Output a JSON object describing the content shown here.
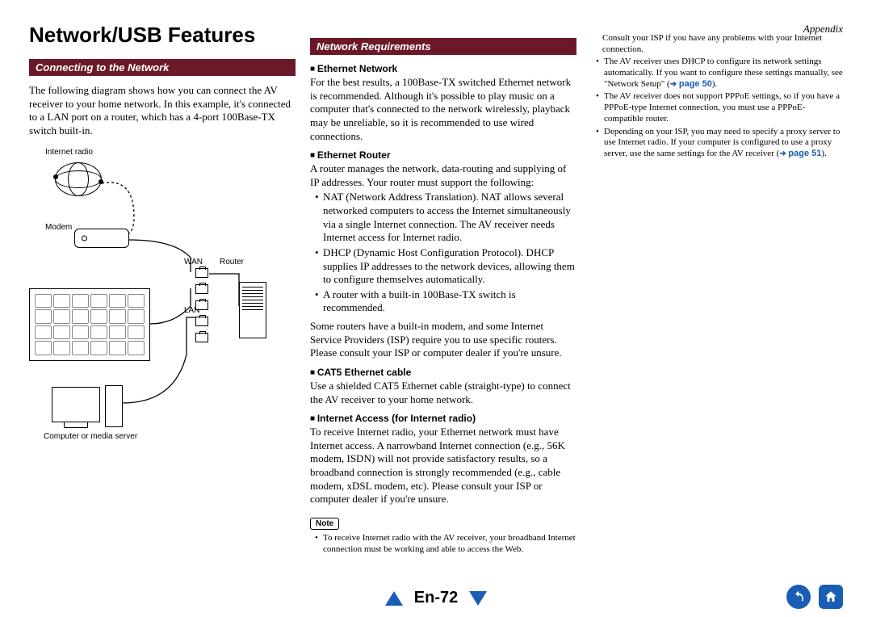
{
  "appendix": "Appendix",
  "heading": "Network/USB Features",
  "section1": {
    "title": "Connecting to the Network",
    "intro": "The following diagram shows how you can connect the AV receiver to your home network. In this example, it's connected to a LAN port on a router, which has a 4-port 100Base-TX switch built-in.",
    "labels": {
      "internet_radio": "Internet radio",
      "modem": "Modem",
      "wan": "WAN",
      "lan": "LAN",
      "router": "Router",
      "computer": "Computer or media server"
    }
  },
  "section2": {
    "title": "Network Requirements",
    "eth_net_h": "Ethernet Network",
    "eth_net_p": "For the best results, a 100Base-TX switched Ethernet network is recommended. Although it's possible to play music on a computer that's connected to the network wirelessly, playback may be unreliable, so it is recommended to use wired connections.",
    "eth_router_h": "Ethernet Router",
    "eth_router_p": "A router manages the network, data-routing and supplying of IP addresses. Your router must support the following:",
    "router_bullets": [
      "NAT (Network Address Translation). NAT allows several networked computers to access the Internet simultaneously via a single Internet connection. The AV receiver needs Internet access for Internet radio.",
      "DHCP (Dynamic Host Configuration Protocol). DHCP supplies IP addresses to the network devices, allowing them to configure themselves automatically.",
      "A router with a built-in 100Base-TX switch is recommended."
    ],
    "router_tail": "Some routers have a built-in modem, and some Internet Service Providers (ISP) require you to use specific routers. Please consult your ISP or computer dealer if you're unsure.",
    "cat5_h": "CAT5 Ethernet cable",
    "cat5_p": "Use a shielded CAT5 Ethernet cable (straight-type) to connect the AV receiver to your home network.",
    "iaccess_h": "Internet Access (for Internet radio)",
    "iaccess_p": "To receive Internet radio, your Ethernet network must have Internet access. A narrowband Internet connection (e.g., 56K modem, ISDN) will not provide satisfactory results, so a broadband connection is strongly recommended (e.g., cable modem, xDSL modem, etc). Please consult your ISP or computer dealer if you're unsure.",
    "note_label": "Note",
    "note_bullet": "To receive Internet radio with the AV receiver, your broadband Internet connection must be working and able to access the Web."
  },
  "col3": {
    "lead": "Consult your ISP if you have any problems with your Internet connection.",
    "b1a": "The AV receiver uses DHCP to configure its network settings automatically. If you want to configure these settings manually, see \"Network Setup\" (",
    "b1_link": "page 50",
    "b1b": ").",
    "b2": "The AV receiver does not support PPPoE settings, so if you have a PPPoE-type Internet connection, you must use a PPPoE-compatible router.",
    "b3a": "Depending on your ISP, you may need to specify a proxy server to use Internet radio. If your computer is configured to use a proxy server, use the same settings for the AV receiver (",
    "b3_link": "page 51",
    "b3b": ")."
  },
  "footer": {
    "page": "En-72"
  }
}
